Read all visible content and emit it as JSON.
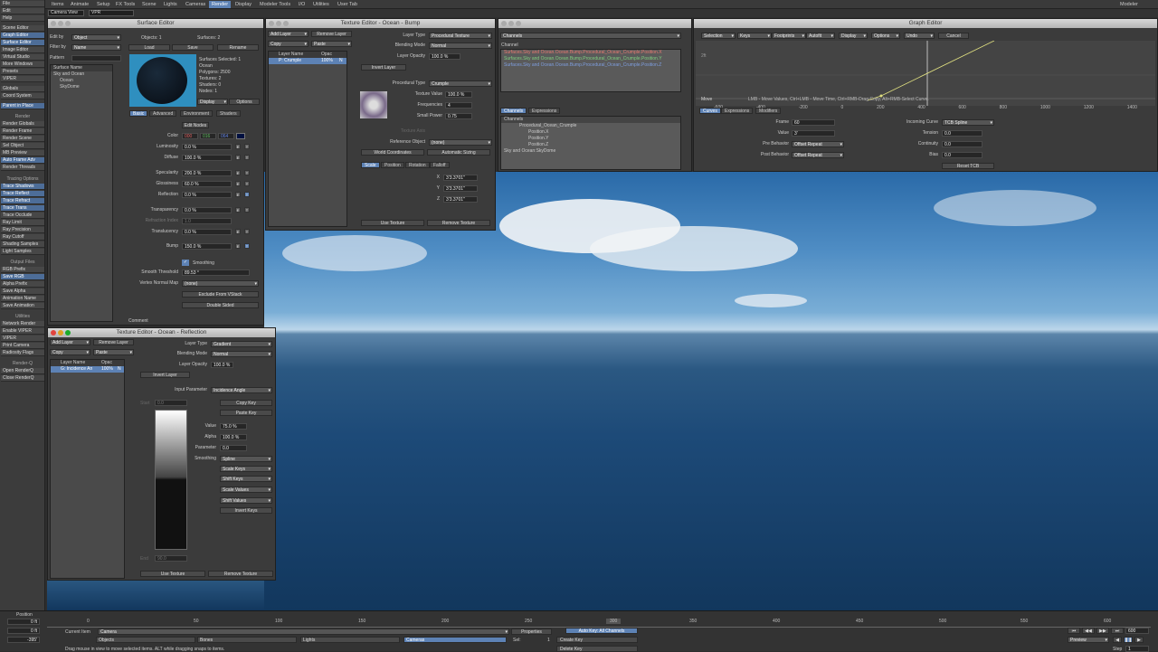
{
  "top_menu": {
    "left_items": [
      "File",
      "Edit",
      "Help"
    ],
    "tabs": [
      "Items",
      "Animate",
      "Setup",
      "FX Tools",
      "Scene",
      "Lights",
      "Cameras",
      "Render",
      "Display",
      "Modeler Tools",
      "I/O",
      "Utilities",
      "User Tab"
    ],
    "selected_tab": "Render",
    "right_label": "Modeler"
  },
  "view_header": {
    "view_mode": "Camera View",
    "render_mode": "VPR"
  },
  "left_panel": {
    "group1": [
      "Scene Editor",
      "Graph Editor",
      "Surface Editor",
      "Image Editor",
      "Virtual Studio",
      "More Windows",
      "Presets",
      "VIPER"
    ],
    "group2": [
      "Globals",
      "Coord System",
      "",
      "Parent in Place"
    ],
    "render_header": "Render",
    "render_items": [
      "Render Globals",
      "Render Frame",
      "Render Scene",
      "Sel Object",
      "MB Preview",
      "Auto Frame Adv",
      "Render Threads"
    ],
    "tracing_header": "Tracing Options",
    "tracing_items": [
      "Trace Shadows",
      "Trace Reflect",
      "Trace Refract",
      "Trace Trans",
      "Trace Occlude",
      "Ray Limit",
      "Ray Precision",
      "Ray Cutoff",
      "Shading Samples",
      "Light Samples"
    ],
    "output_header": "Output Files",
    "output_items": [
      "RGB Prefix",
      "Save RGB",
      "Alpha Prefix",
      "Save Alpha",
      "Animation Name",
      "Save Animation"
    ],
    "utilities_header": "Utilities",
    "utilities_items": [
      "Network Render",
      "Enable VIPER",
      "Print Camera",
      "Radiosity Flags",
      "VIPER"
    ],
    "renderq_header": "Render-Q",
    "renderq_items": [
      "Open RenderQ",
      "Close RenderQ"
    ]
  },
  "surface_editor": {
    "title": "Surface Editor",
    "edit_by_label": "Edit by",
    "edit_by": "Object",
    "filter_by_label": "Filter by",
    "filter_by": "Name",
    "pattern_label": "Pattern",
    "objects_label": "Objects: 1",
    "surfaces_label": "Surfaces: 2",
    "load": "Load",
    "save": "Save",
    "rename": "Rename",
    "list_header": "Surface Name",
    "surfaces": [
      "Sky and Ocean",
      "Ocean",
      "SkyDome"
    ],
    "info": [
      "Surfaces Selected: 1",
      "Ocean",
      "Polygons: 2500",
      "Textures: 2",
      "Shaders: 0",
      "Nodes: 1"
    ],
    "display": "Display",
    "options": "Options",
    "tabs": [
      "Basic",
      "Advanced",
      "Environment",
      "Shaders"
    ],
    "edit_nodes": "Edit Nodes",
    "color_label": "Color",
    "color_r": "000",
    "color_g": "016",
    "color_b": "064",
    "props": [
      {
        "label": "Luminosity",
        "value": "0.0 %"
      },
      {
        "label": "Diffuse",
        "value": "100.0 %"
      },
      {
        "label": "Specularity",
        "value": "200.0 %"
      },
      {
        "label": "Glossiness",
        "value": "60.0 %"
      },
      {
        "label": "Reflection",
        "value": "0.0 %"
      },
      {
        "label": "Transparency",
        "value": "0.0 %"
      },
      {
        "label": "Refraction Index",
        "value": "1.0"
      },
      {
        "label": "Translucency",
        "value": "0.0 %"
      },
      {
        "label": "Bump",
        "value": "150.0 %"
      }
    ],
    "smoothing": "Smoothing",
    "smooth_threshold_label": "Smooth Threshold",
    "smooth_threshold": "89.53 °",
    "vnm_label": "Vertex Normal Map",
    "vnm": "(none)",
    "exclude_vstack": "Exclude From VStack",
    "double_sided": "Double Sided",
    "comment": "Comment"
  },
  "texture_bump": {
    "title": "Texture Editor - Ocean - Bump",
    "add_layer": "Add Layer",
    "remove_layer": "Remove Layer",
    "copy": "Copy",
    "paste": "Paste",
    "col_layer_name": "Layer Name",
    "col_opac": "Opac",
    "layer_name": "P: Crumple",
    "layer_opac": "100%",
    "layer_flag": "N",
    "layer_type_label": "Layer Type",
    "layer_type": "Procedural Texture",
    "blending_label": "Blending Mode",
    "blending": "Normal",
    "opacity_label": "Layer Opacity",
    "opacity": "100.0 %",
    "invert_layer": "Invert Layer",
    "proc_type_label": "Procedural Type",
    "proc_type": "Crumple",
    "tex_value_label": "Texture Value",
    "tex_value": "100.0 %",
    "freq_label": "Frequencies",
    "freq": "4",
    "small_power_label": "Small Power",
    "small_power": "0.75",
    "texture_axis_label": "Texture Axis",
    "ref_obj_label": "Reference Object",
    "ref_obj": "(none)",
    "world_coords": "World Coordinates",
    "auto_sizing": "Automatic Sizing",
    "tabs": [
      "Scale",
      "Position",
      "Rotation",
      "Falloff"
    ],
    "x_label": "X",
    "x": "3'3.3701\"",
    "y_label": "Y",
    "y": "3'3.3701\"",
    "z_label": "Z",
    "z": "3'3.3701\"",
    "use_texture": "Use Texture",
    "remove_texture": "Remove Texture"
  },
  "texture_reflection": {
    "title": "Texture Editor - Ocean - Reflection",
    "add_layer": "Add Layer",
    "remove_layer": "Remove Layer",
    "copy": "Copy",
    "paste": "Paste",
    "col_layer_name": "Layer Name",
    "col_opac": "Opac",
    "layer_name": "G: Incidence An",
    "layer_opac": "100%",
    "layer_flag": "N",
    "layer_type_label": "Layer Type",
    "layer_type": "Gradient",
    "blending_label": "Blending Mode",
    "blending": "Normal",
    "opacity_label": "Layer Opacity",
    "opacity": "100.0 %",
    "invert_layer": "Invert Layer",
    "input_param_label": "Input Parameter",
    "input_param": "Incidence Angle",
    "start_label": "Start",
    "start": "0.0",
    "end_label": "End",
    "end": "90.0",
    "copy_key": "Copy Key",
    "paste_key": "Paste Key",
    "value_label": "Value",
    "value": "75.0 %",
    "alpha_label": "Alpha",
    "alpha": "100.0 %",
    "parameter_label": "Parameter",
    "parameter": "0.0",
    "smoothing_label": "Smoothing",
    "smoothing": "Spline",
    "scale_keys": "Scale Keys",
    "shift_keys": "Shift Keys",
    "scale_values": "Scale Values",
    "shift_values": "Shift Values",
    "invert_keys": "Invert Keys",
    "use_texture": "Use Texture",
    "remove_texture": "Remove Texture"
  },
  "channel_panel": {
    "channels_label": "Channels",
    "channel_label": "Channel",
    "channel_rows": [
      "Surfaces.Sky and Ocean.Ocean.Bump.Procedural_Ocean_Crumple.Position.X",
      "Surfaces.Sky and Ocean.Ocean.Bump.Procedural_Ocean_Crumple.Position.Y",
      "Surfaces.Sky and Ocean.Ocean.Bump.Procedural_Ocean_Crumple.Position.Z"
    ],
    "tabs": [
      "Channels",
      "Expressions"
    ],
    "tree_header": "Channels",
    "tree": [
      "Procedural_Ocean_Crumple",
      "Position.X",
      "Position.Y",
      "Position.Z",
      "Sky and Ocean:SkyDome"
    ]
  },
  "graph_editor": {
    "title": "Graph Editor",
    "menus": [
      "Selection",
      "Keys",
      "Footprints",
      "Autofit",
      "Display",
      "Options",
      "Undo",
      "Cancel"
    ],
    "hint": "LMB - Move Values, Ctrl+LMB - Move Time, Ctrl+RMB-Drag Copy, Alt+RMB-Select Curve.",
    "move": "Move",
    "y_tick": "2ft",
    "x_ticks": [
      "-600",
      "-400",
      "-200",
      "0",
      "200",
      "400",
      "600",
      "800",
      "1000",
      "1200",
      "1400"
    ],
    "curve_tabs": [
      "Curves",
      "Expressions",
      "Modifiers"
    ],
    "frame_label": "Frame",
    "frame": "60",
    "value_label": "Value",
    "value": "3'",
    "pre_label": "Pre Behavior",
    "pre": "Offset Repeat",
    "post_label": "Post Behavior",
    "post": "Offset Repeat",
    "incoming_label": "Incoming Curve",
    "incoming": "TCB Spline",
    "tension_label": "Tension",
    "tension": "0.0",
    "continuity_label": "Continuity",
    "continuity": "0.0",
    "bias_label": "Bias",
    "bias": "0.0",
    "reset_tcb": "Reset TCB"
  },
  "timeline": {
    "ticks": [
      "0",
      "50",
      "100",
      "150",
      "200",
      "250",
      "300",
      "350",
      "400",
      "450",
      "500",
      "550",
      "600"
    ],
    "position_label": "Position",
    "pos_values": [
      "0 ft",
      "0 ft",
      "-395'"
    ],
    "current_item_label": "Current Item",
    "current_item": "Camera",
    "objects": "Objects",
    "bones": "Bones",
    "lights": "Lights",
    "cameras": "Cameras",
    "properties": "Properties",
    "sel_label": "Sel:",
    "sel": "1",
    "auto_key": "Auto Key: All Channels",
    "create_key": "Create Key",
    "delete_key": "Delete Key",
    "status": "Drag mouse in view to move selected items. ALT while dragging snaps to items.",
    "preview": "Preview",
    "step_label": "Step",
    "step": "1",
    "end_frame": "600",
    "frame_marker": "300"
  }
}
